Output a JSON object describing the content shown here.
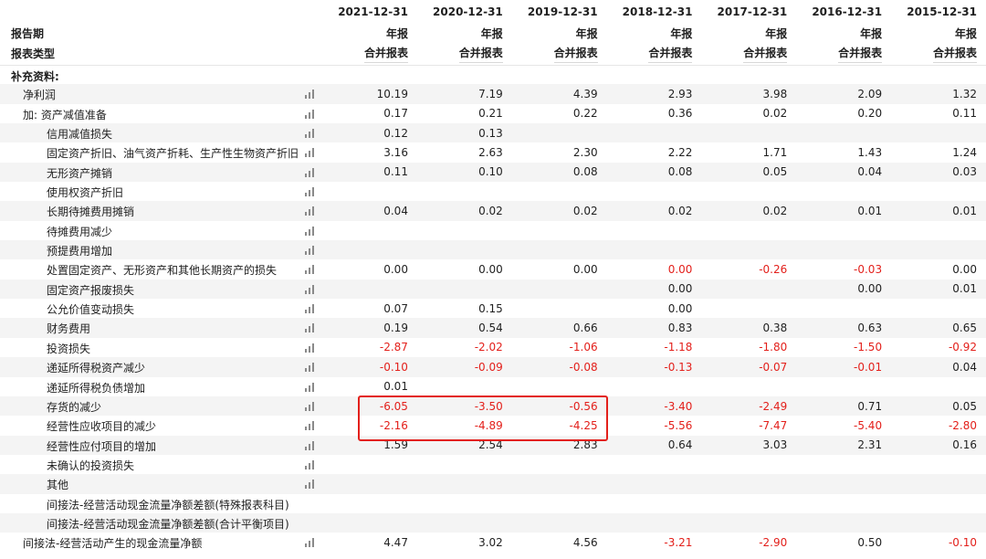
{
  "header": {
    "period_label": "报告期",
    "type_label": "报表类型",
    "columns": [
      {
        "date": "2021-12-31",
        "period": "年报",
        "type": "合并报表"
      },
      {
        "date": "2020-12-31",
        "period": "年报",
        "type": "合并报表"
      },
      {
        "date": "2019-12-31",
        "period": "年报",
        "type": "合并报表"
      },
      {
        "date": "2018-12-31",
        "period": "年报",
        "type": "合并报表"
      },
      {
        "date": "2017-12-31",
        "period": "年报",
        "type": "合并报表"
      },
      {
        "date": "2016-12-31",
        "period": "年报",
        "type": "合并报表"
      },
      {
        "date": "2015-12-31",
        "period": "年报",
        "type": "合并报表"
      }
    ]
  },
  "rows": [
    {
      "label": "补充资料:",
      "indent": 0,
      "chart": false,
      "values": [
        "",
        "",
        "",
        "",
        "",
        "",
        ""
      ]
    },
    {
      "label": "净利润",
      "indent": 1,
      "chart": true,
      "values": [
        "10.19",
        "7.19",
        "4.39",
        "2.93",
        "3.98",
        "2.09",
        "1.32"
      ]
    },
    {
      "label": "加: 资产减值准备",
      "indent": 1,
      "chart": true,
      "values": [
        "0.17",
        "0.21",
        "0.22",
        "0.36",
        "0.02",
        "0.20",
        "0.11"
      ]
    },
    {
      "label": "信用减值损失",
      "indent": 2,
      "chart": true,
      "values": [
        "0.12",
        "0.13",
        "",
        "",
        "",
        "",
        ""
      ]
    },
    {
      "label": "固定资产折旧、油气资产折耗、生产性生物资产折旧",
      "indent": 2,
      "chart": true,
      "values": [
        "3.16",
        "2.63",
        "2.30",
        "2.22",
        "1.71",
        "1.43",
        "1.24"
      ]
    },
    {
      "label": "无形资产摊销",
      "indent": 2,
      "chart": true,
      "values": [
        "0.11",
        "0.10",
        "0.08",
        "0.08",
        "0.05",
        "0.04",
        "0.03"
      ]
    },
    {
      "label": "使用权资产折旧",
      "indent": 2,
      "chart": true,
      "values": [
        "",
        "",
        "",
        "",
        "",
        "",
        ""
      ]
    },
    {
      "label": "长期待摊费用摊销",
      "indent": 2,
      "chart": true,
      "values": [
        "0.04",
        "0.02",
        "0.02",
        "0.02",
        "0.02",
        "0.01",
        "0.01"
      ]
    },
    {
      "label": "待摊费用减少",
      "indent": 2,
      "chart": true,
      "values": [
        "",
        "",
        "",
        "",
        "",
        "",
        ""
      ]
    },
    {
      "label": "预提费用增加",
      "indent": 2,
      "chart": true,
      "values": [
        "",
        "",
        "",
        "",
        "",
        "",
        ""
      ]
    },
    {
      "label": "处置固定资产、无形资产和其他长期资产的损失",
      "indent": 2,
      "chart": true,
      "values": [
        "0.00",
        "0.00",
        "0.00",
        "0.00",
        "-0.26",
        "-0.03",
        "0.00"
      ],
      "neg_cols": [
        3
      ]
    },
    {
      "label": "固定资产报废损失",
      "indent": 2,
      "chart": true,
      "values": [
        "",
        "",
        "",
        "0.00",
        "",
        "0.00",
        "0.01"
      ]
    },
    {
      "label": "公允价值变动损失",
      "indent": 2,
      "chart": true,
      "values": [
        "0.07",
        "0.15",
        "",
        "0.00",
        "",
        "",
        ""
      ]
    },
    {
      "label": "财务费用",
      "indent": 2,
      "chart": true,
      "values": [
        "0.19",
        "0.54",
        "0.66",
        "0.83",
        "0.38",
        "0.63",
        "0.65"
      ]
    },
    {
      "label": "投资损失",
      "indent": 2,
      "chart": true,
      "values": [
        "-2.87",
        "-2.02",
        "-1.06",
        "-1.18",
        "-1.80",
        "-1.50",
        "-0.92"
      ]
    },
    {
      "label": "递延所得税资产减少",
      "indent": 2,
      "chart": true,
      "values": [
        "-0.10",
        "-0.09",
        "-0.08",
        "-0.13",
        "-0.07",
        "-0.01",
        "0.04"
      ]
    },
    {
      "label": "递延所得税负债增加",
      "indent": 2,
      "chart": true,
      "values": [
        "0.01",
        "",
        "",
        "",
        "",
        "",
        ""
      ]
    },
    {
      "label": "存货的减少",
      "indent": 2,
      "chart": true,
      "values": [
        "-6.05",
        "-3.50",
        "-0.56",
        "-3.40",
        "-2.49",
        "0.71",
        "0.05"
      ]
    },
    {
      "label": "经营性应收项目的减少",
      "indent": 2,
      "chart": true,
      "values": [
        "-2.16",
        "-4.89",
        "-4.25",
        "-5.56",
        "-7.47",
        "-5.40",
        "-2.80"
      ]
    },
    {
      "label": "经营性应付项目的增加",
      "indent": 2,
      "chart": true,
      "values": [
        "1.59",
        "2.54",
        "2.83",
        "0.64",
        "3.03",
        "2.31",
        "0.16"
      ]
    },
    {
      "label": "未确认的投资损失",
      "indent": 2,
      "chart": true,
      "values": [
        "",
        "",
        "",
        "",
        "",
        "",
        ""
      ]
    },
    {
      "label": "其他",
      "indent": 2,
      "chart": true,
      "values": [
        "",
        "",
        "",
        "",
        "",
        "",
        ""
      ]
    },
    {
      "label": "间接法-经营活动现金流量净额差额(特殊报表科目)",
      "indent": 2,
      "chart": false,
      "values": [
        "",
        "",
        "",
        "",
        "",
        "",
        ""
      ]
    },
    {
      "label": "间接法-经营活动现金流量净额差额(合计平衡项目)",
      "indent": 2,
      "chart": false,
      "values": [
        "",
        "",
        "",
        "",
        "",
        "",
        ""
      ]
    },
    {
      "label": "间接法-经营活动产生的现金流量净额",
      "indent": 1,
      "chart": true,
      "values": [
        "4.47",
        "3.02",
        "4.56",
        "-3.21",
        "-2.90",
        "0.50",
        "-0.10"
      ]
    }
  ],
  "colors": {
    "negative": "#e3201b",
    "highlight_box": "#e3201b",
    "stripe": "#f4f4f4"
  },
  "highlight": {
    "rows": [
      "存货的减少",
      "经营性应收项目的减少"
    ],
    "columns": [
      "2021-12-31",
      "2020-12-31",
      "2019-12-31"
    ]
  }
}
